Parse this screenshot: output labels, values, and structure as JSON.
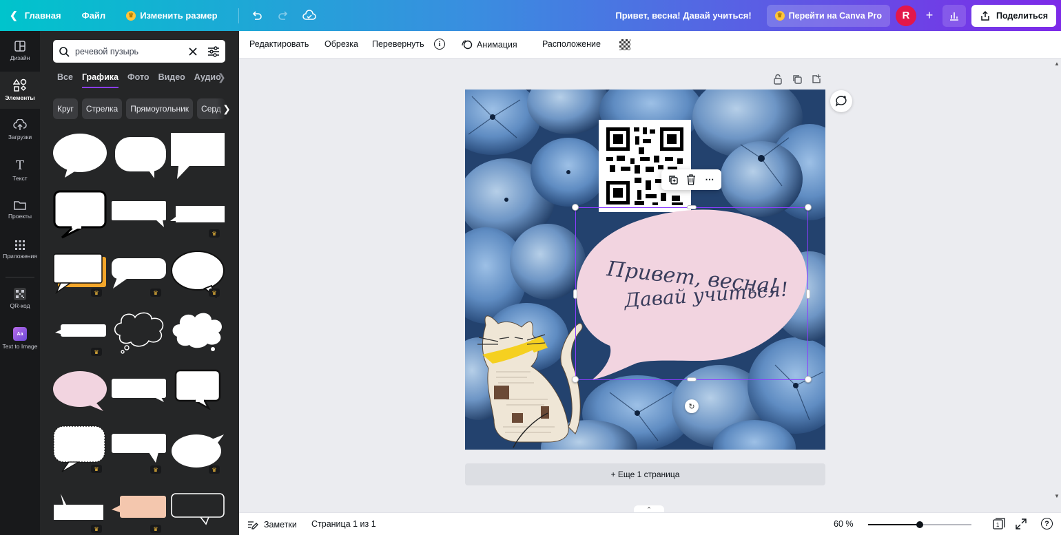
{
  "topbar": {
    "home": "Главная",
    "file": "Файл",
    "resize": "Изменить размер",
    "doc_title": "Привет, весна! Давай учиться!",
    "pro": "Перейти на Canva Pro",
    "avatar_letter": "R",
    "share": "Поделиться"
  },
  "rail": [
    {
      "label": "Дизайн",
      "icon": "layout-icon"
    },
    {
      "label": "Элементы",
      "icon": "shapes-icon"
    },
    {
      "label": "Загрузки",
      "icon": "cloud-upload-icon"
    },
    {
      "label": "Текст",
      "icon": "text-icon"
    },
    {
      "label": "Проекты",
      "icon": "folder-icon"
    },
    {
      "label": "Приложения",
      "icon": "apps-grid-icon"
    },
    {
      "label": "QR-код",
      "icon": "qr-code-icon"
    },
    {
      "label": "Text to Image",
      "icon": "text-to-image-icon"
    }
  ],
  "panel": {
    "search_value": "речевой пузырь",
    "tabs": [
      "Все",
      "Графика",
      "Фото",
      "Видео",
      "Аудио"
    ],
    "active_tab": "Графика",
    "chips": [
      "Круг",
      "Стрелка",
      "Прямоугольник",
      "Серд"
    ]
  },
  "toolbar": {
    "edit": "Редактировать",
    "crop": "Обрезка",
    "flip": "Перевернуть",
    "info": "i",
    "animation": "Анимация",
    "position": "Расположение"
  },
  "canvas": {
    "handwriting_line1": "Привет,  весна!",
    "handwriting_line2": "Давай  учиться!",
    "add_page": "+ Еще 1 страница"
  },
  "footer": {
    "notes": "Заметки",
    "page_info": "Страница 1 из 1",
    "zoom": "60 %",
    "zoom_fraction": 0.5,
    "page_count": "1",
    "help": "?"
  },
  "colors": {
    "accent": "#8b3dff",
    "bubble_pink": "#f2d4e0",
    "panel_bg": "#252627",
    "rail_bg": "#18191b",
    "crown": "#ffc53d"
  }
}
